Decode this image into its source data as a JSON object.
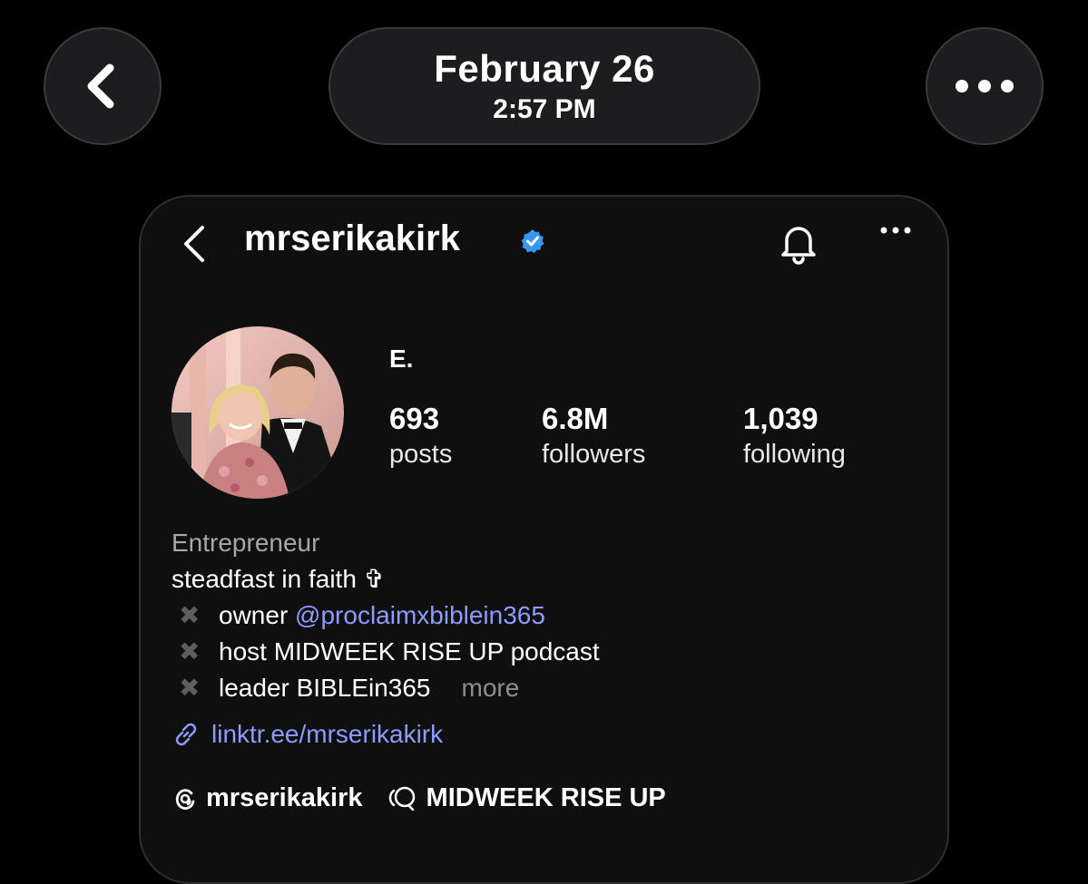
{
  "header": {
    "date": "February 26",
    "time": "2:57 PM"
  },
  "profile": {
    "username": "mrserikakirk",
    "display_name": "E.",
    "stats": {
      "posts_count": "693",
      "posts_label": "posts",
      "followers_count": "6.8M",
      "followers_label": "followers",
      "following_count": "1,039",
      "following_label": "following"
    },
    "bio": {
      "category": "Entrepreneur",
      "line1": "steadfast in faith ✞",
      "bullet": "✖",
      "line2_prefix": "owner ",
      "line2_mention": "@proclaimxbiblein365",
      "line3": "host MIDWEEK RISE UP podcast",
      "line4": "leader BIBLEin365",
      "more": "more"
    },
    "link": "linktr.ee/mrserikakirk",
    "threads_badge": "mrserikakirk",
    "channel_badge": "MIDWEEK RISE UP"
  },
  "colors": {
    "accent_link": "#8c9cff",
    "verified_blue": "#3897f0"
  },
  "icons": [
    "chevron-left-icon",
    "more-horizontal-icon",
    "verified-badge-icon",
    "bell-icon",
    "link-icon",
    "threads-icon",
    "broadcast-channel-icon"
  ]
}
